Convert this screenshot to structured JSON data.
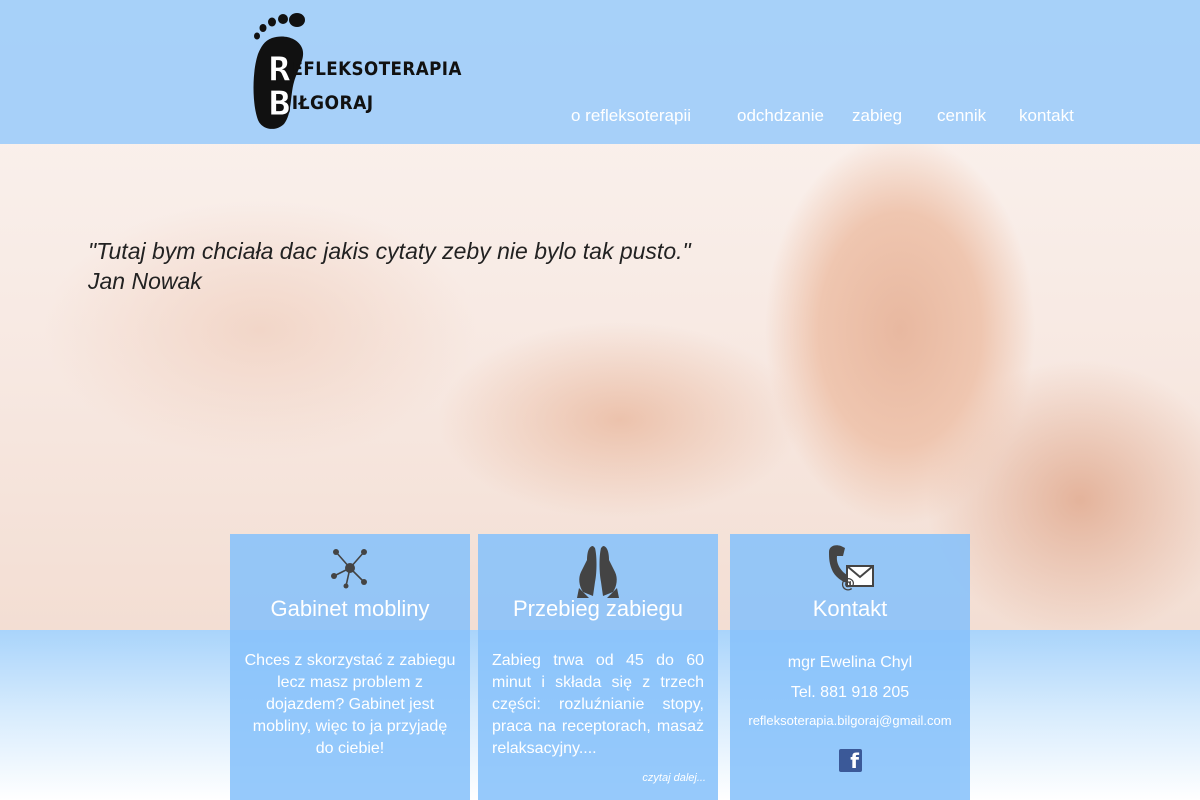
{
  "brand": {
    "line1_initial": "R",
    "line1_rest": "EFLEKSOTERAPIA",
    "line2_initial": "B",
    "line2_rest": "IŁGORAJ"
  },
  "nav": {
    "items": [
      {
        "label": "o refleksoterapii"
      },
      {
        "label": "odchdzanie"
      },
      {
        "label": "zabieg"
      },
      {
        "label": "cennik"
      },
      {
        "label": "kontakt"
      }
    ]
  },
  "hero": {
    "quote": "\"Tutaj bym chciała dac jakis cytaty  zeby nie bylo tak pusto.\"",
    "author": "Jan Nowak"
  },
  "boxes": {
    "mobile": {
      "icon": "network-icon",
      "title": "Gabinet moblinу",
      "text": "Chces z skorzystać z zabiegu lecz masz problem z dojazdem? Gabinet  jest mobliny, więc to ja przyjadę do ciebie!"
    },
    "procedure": {
      "icon": "foot-hands-icon",
      "title": "Przebieg zabiegu",
      "text": "Zabieg trwa od 45 do 60 minut i składa się z trzech części: rozluźnianie stopy, praca na receptorach, masaż relaksacyjny....",
      "more": "czytaj dalej..."
    },
    "contact": {
      "icon": "phone-mail-icon",
      "title": "Kontakt",
      "name": "mgr Ewelina Chyl",
      "phone": "Tel. 881 918 205",
      "email": "refleksoterapia.bilgoraj@gmail.com",
      "social": "facebook-icon"
    }
  },
  "colors": {
    "header": "#a0cefa",
    "box": "#88c2fa",
    "facebook": "#3b5998"
  }
}
